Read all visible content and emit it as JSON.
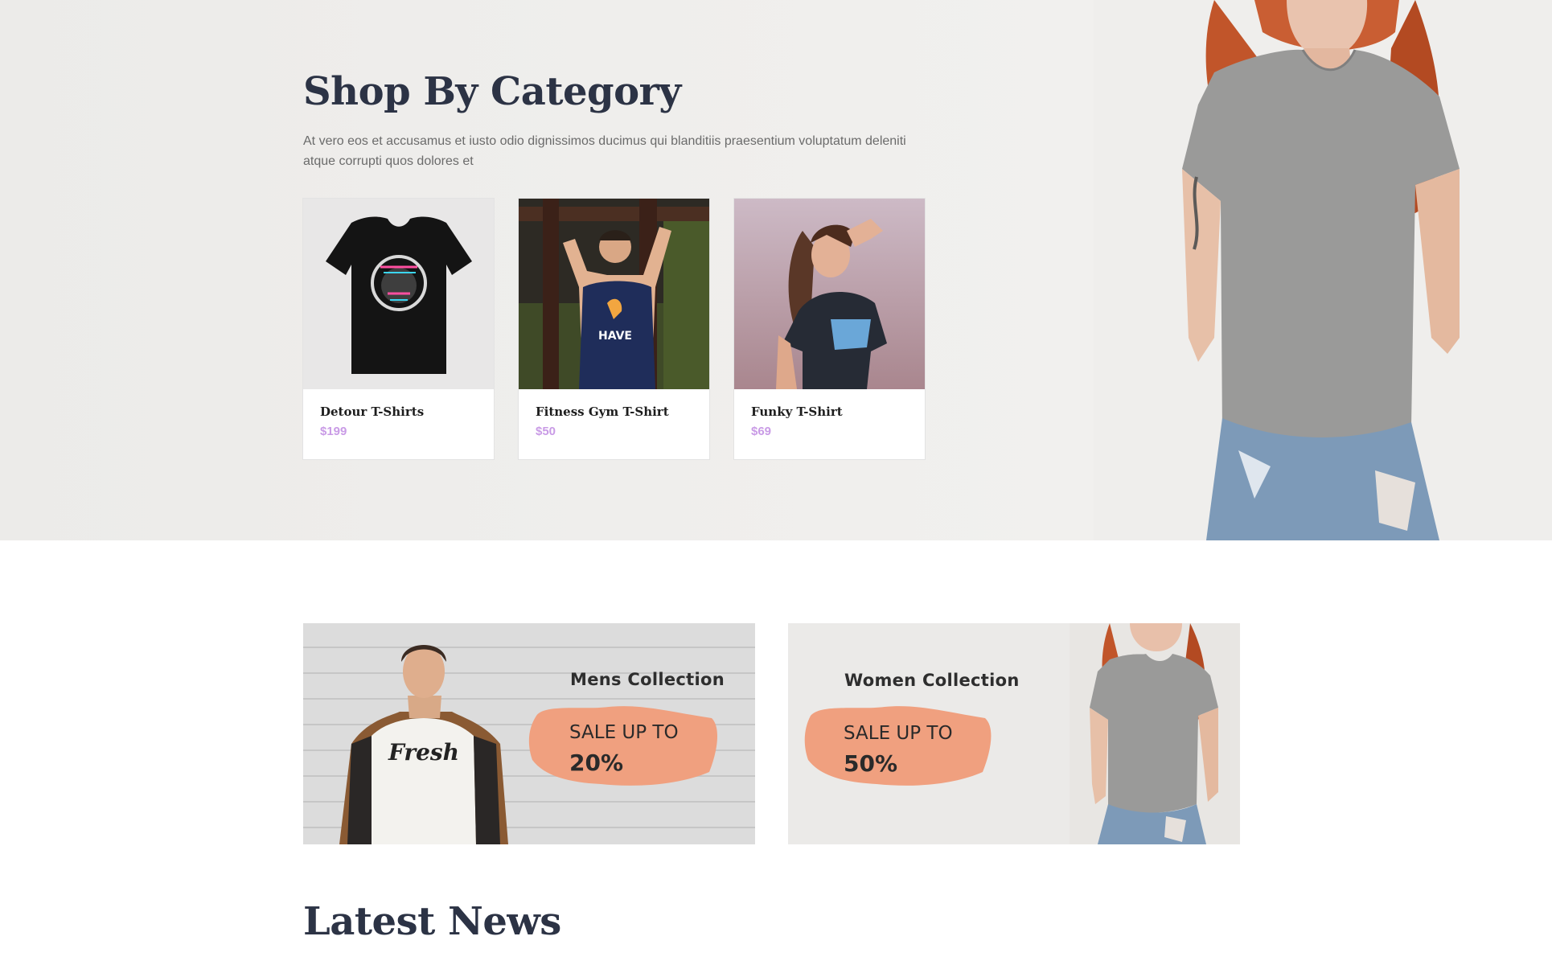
{
  "shop": {
    "title": "Shop By Category",
    "description": "At vero eos et accusamus et iusto odio dignissimos ducimus qui blanditiis praesentium voluptatum deleniti atque corrupti quos dolores et"
  },
  "products": [
    {
      "name": "Detour T-Shirts",
      "price": "$199"
    },
    {
      "name": "Fitness Gym T-Shirt",
      "price": "$50"
    },
    {
      "name": "Funky T-Shirt",
      "price": "$69"
    }
  ],
  "promos": [
    {
      "title": "Mens Collection",
      "sale": "SALE UP TO",
      "percent": "20%"
    },
    {
      "title": "Women Collection",
      "sale": "SALE UP TO",
      "percent": "50%"
    }
  ],
  "news": {
    "title": "Latest News"
  },
  "colors": {
    "heading": "#2c3345",
    "price": "#c99be6",
    "brush": "#f0a07f"
  }
}
